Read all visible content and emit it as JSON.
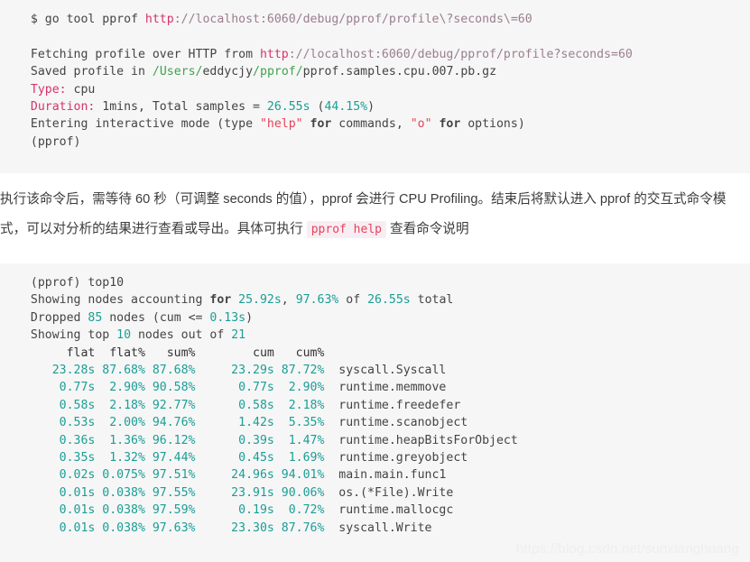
{
  "code_block_1": {
    "name": "pprof-command-output",
    "lines": [
      {
        "segments": [
          {
            "t": "  $ go tool pprof ",
            "c": "plain"
          },
          {
            "t": "http",
            "c": "kw"
          },
          {
            "t": "://localhost:6060/debug/pprof/profile\\?seconds\\=60",
            "c": "url"
          }
        ]
      },
      {
        "segments": [
          {
            "t": "",
            "c": "plain"
          }
        ]
      },
      {
        "segments": [
          {
            "t": "  Fetching profile over HTTP from ",
            "c": "plain"
          },
          {
            "t": "http",
            "c": "kw"
          },
          {
            "t": "://localhost:6060/debug/pprof/profile?seconds=60",
            "c": "url"
          }
        ]
      },
      {
        "segments": [
          {
            "t": "  Saved profile in ",
            "c": "plain"
          },
          {
            "t": "/",
            "c": "green"
          },
          {
            "t": "Users",
            "c": "green"
          },
          {
            "t": "/",
            "c": "green"
          },
          {
            "t": "eddycjy",
            "c": "plain"
          },
          {
            "t": "/",
            "c": "green"
          },
          {
            "t": "pprof",
            "c": "green"
          },
          {
            "t": "/",
            "c": "green"
          },
          {
            "t": "pprof.samples.cpu.007.pb.gz",
            "c": "plain"
          }
        ]
      },
      {
        "segments": [
          {
            "t": "  Type:",
            "c": "kw"
          },
          {
            "t": " cpu",
            "c": "plain"
          }
        ]
      },
      {
        "segments": [
          {
            "t": "  Duration:",
            "c": "kw"
          },
          {
            "t": " 1mins, Total samples = ",
            "c": "plain"
          },
          {
            "t": "26.55s",
            "c": "num"
          },
          {
            "t": " (",
            "c": "plain"
          },
          {
            "t": "44.15%",
            "c": "num"
          },
          {
            "t": ")",
            "c": "plain"
          }
        ]
      },
      {
        "segments": [
          {
            "t": "  Entering interactive mode (type ",
            "c": "plain"
          },
          {
            "t": "\"help\"",
            "c": "str"
          },
          {
            "t": " for",
            "c": "bold"
          },
          {
            "t": " commands, ",
            "c": "plain"
          },
          {
            "t": "\"o\"",
            "c": "str"
          },
          {
            "t": " for",
            "c": "bold"
          },
          {
            "t": " options)",
            "c": "plain"
          }
        ]
      },
      {
        "segments": [
          {
            "t": "  (pprof)",
            "c": "plain"
          }
        ]
      }
    ]
  },
  "prose": {
    "name": "explanation-paragraph",
    "part1": "执行该命令后，需等待 60 秒（可调整 seconds 的值），pprof 会进行 CPU Profiling。结束后将默认进入 pprof 的交互式命令模式，可以对分析的结果进行查看或导出。具体可执行 ",
    "inline_code": "pprof help",
    "part2": " 查看命令说明"
  },
  "code_block_2": {
    "name": "pprof-top10-output",
    "prompt_line": "  (pprof) top10",
    "summary": {
      "showing_nodes_prefix": "  Showing nodes accounting ",
      "showing_nodes_for": "for",
      "flat_total": "25.92s",
      "flat_pct": "97.63%",
      "cum_total": "26.55s",
      "dropped_count": "85",
      "dropped_cum": "0.13s",
      "top_n": "10",
      "out_of": "21"
    },
    "columns": [
      "flat",
      "flat%",
      "sum%",
      "cum",
      "cum%",
      ""
    ],
    "header_line": "       flat  flat%   sum%        cum   cum%",
    "rows": [
      {
        "flat": "23.28s",
        "flatpct": "87.68%",
        "sumpct": "87.68%",
        "cum": "23.29s",
        "cumpct": "87.72%",
        "func": "syscall.Syscall"
      },
      {
        "flat": "0.77s",
        "flatpct": "2.90%",
        "sumpct": "90.58%",
        "cum": "0.77s",
        "cumpct": "2.90%",
        "func": "runtime.memmove"
      },
      {
        "flat": "0.58s",
        "flatpct": "2.18%",
        "sumpct": "92.77%",
        "cum": "0.58s",
        "cumpct": "2.18%",
        "func": "runtime.freedefer"
      },
      {
        "flat": "0.53s",
        "flatpct": "2.00%",
        "sumpct": "94.76%",
        "cum": "1.42s",
        "cumpct": "5.35%",
        "func": "runtime.scanobject"
      },
      {
        "flat": "0.36s",
        "flatpct": "1.36%",
        "sumpct": "96.12%",
        "cum": "0.39s",
        "cumpct": "1.47%",
        "func": "runtime.heapBitsForObject"
      },
      {
        "flat": "0.35s",
        "flatpct": "1.32%",
        "sumpct": "97.44%",
        "cum": "0.45s",
        "cumpct": "1.69%",
        "func": "runtime.greyobject"
      },
      {
        "flat": "0.02s",
        "flatpct": "0.075%",
        "sumpct": "97.51%",
        "cum": "24.96s",
        "cumpct": "94.01%",
        "func": "main.main.func1"
      },
      {
        "flat": "0.01s",
        "flatpct": "0.038%",
        "sumpct": "97.55%",
        "cum": "23.91s",
        "cumpct": "90.06%",
        "func": "os.(*File).Write"
      },
      {
        "flat": "0.01s",
        "flatpct": "0.038%",
        "sumpct": "97.59%",
        "cum": "0.19s",
        "cumpct": "0.72%",
        "func": "runtime.mallocgc"
      },
      {
        "flat": "0.01s",
        "flatpct": "0.038%",
        "sumpct": "97.63%",
        "cum": "23.30s",
        "cumpct": "87.76%",
        "func": "syscall.Write"
      }
    ]
  },
  "watermark": {
    "text": "https://blog.csdn.net/sunxianghuang"
  },
  "colors": {
    "code_background": "#f6f6f6",
    "page_background": "#ffffff",
    "keyword": "#d6336c",
    "string": "#e8415c",
    "number": "#1a9e96",
    "path": "#3fa34d",
    "url": "#9b7e8f",
    "text": "#444444",
    "watermark": "#eeeeee"
  }
}
